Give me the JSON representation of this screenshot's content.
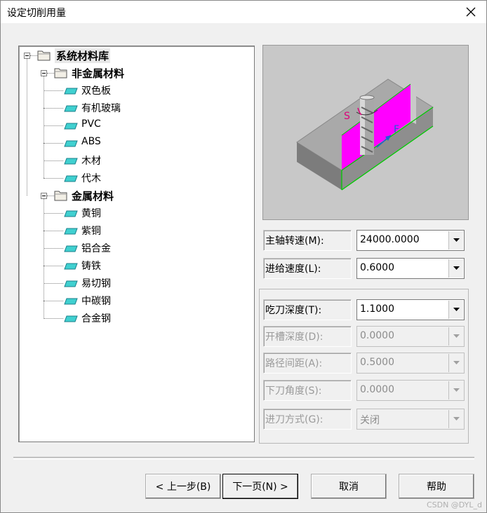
{
  "window": {
    "title": "设定切削用量"
  },
  "tree": {
    "root": "系统材料库",
    "groups": [
      {
        "label": "非金属材料",
        "items": [
          "双色板",
          "有机玻璃",
          "PVC",
          "ABS",
          "木材",
          "代木"
        ]
      },
      {
        "label": "金属材料",
        "items": [
          "黄铜",
          "紫铜",
          "铝合金",
          "铸铁",
          "易切钢",
          "中碳钢",
          "合金钢"
        ]
      }
    ]
  },
  "preview": {
    "label_s": "S",
    "label_f": "F"
  },
  "fields": {
    "spindle_speed": {
      "label": "主轴转速(M):",
      "value": "24000.0000",
      "enabled": true
    },
    "feed_rate": {
      "label": "进给速度(L):",
      "value": "0.6000",
      "enabled": true
    },
    "cut_depth": {
      "label": "吃刀深度(T):",
      "value": "1.1000",
      "enabled": true
    },
    "slot_depth": {
      "label": "开槽深度(D):",
      "value": "0.0000",
      "enabled": false
    },
    "path_spacing": {
      "label": "路径间距(A):",
      "value": "0.5000",
      "enabled": false
    },
    "plunge_angle": {
      "label": "下刀角度(S):",
      "value": "0.0000",
      "enabled": false
    },
    "entry_mode": {
      "label": "进刀方式(G):",
      "value": "关闭",
      "enabled": false
    }
  },
  "buttons": {
    "prev": "< 上一步(B)",
    "next": "下一页(N) >",
    "cancel": "取消",
    "help": "帮助"
  },
  "watermark": "CSDN @DYL_d",
  "colors": {
    "accent_magenta": "#ff00ff",
    "edge_green": "#00cc00",
    "feed_arrow": "#1e5fd6"
  }
}
